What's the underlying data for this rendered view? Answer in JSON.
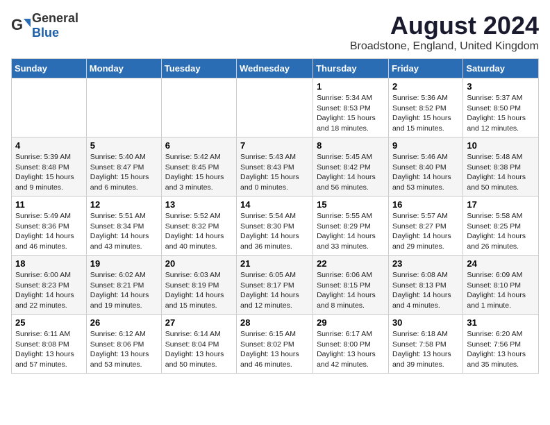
{
  "header": {
    "logo_general": "General",
    "logo_blue": "Blue",
    "month_year": "August 2024",
    "location": "Broadstone, England, United Kingdom"
  },
  "days_of_week": [
    "Sunday",
    "Monday",
    "Tuesday",
    "Wednesday",
    "Thursday",
    "Friday",
    "Saturday"
  ],
  "weeks": [
    [
      {
        "day": "",
        "info": ""
      },
      {
        "day": "",
        "info": ""
      },
      {
        "day": "",
        "info": ""
      },
      {
        "day": "",
        "info": ""
      },
      {
        "day": "1",
        "info": "Sunrise: 5:34 AM\nSunset: 8:53 PM\nDaylight: 15 hours\nand 18 minutes."
      },
      {
        "day": "2",
        "info": "Sunrise: 5:36 AM\nSunset: 8:52 PM\nDaylight: 15 hours\nand 15 minutes."
      },
      {
        "day": "3",
        "info": "Sunrise: 5:37 AM\nSunset: 8:50 PM\nDaylight: 15 hours\nand 12 minutes."
      }
    ],
    [
      {
        "day": "4",
        "info": "Sunrise: 5:39 AM\nSunset: 8:48 PM\nDaylight: 15 hours\nand 9 minutes."
      },
      {
        "day": "5",
        "info": "Sunrise: 5:40 AM\nSunset: 8:47 PM\nDaylight: 15 hours\nand 6 minutes."
      },
      {
        "day": "6",
        "info": "Sunrise: 5:42 AM\nSunset: 8:45 PM\nDaylight: 15 hours\nand 3 minutes."
      },
      {
        "day": "7",
        "info": "Sunrise: 5:43 AM\nSunset: 8:43 PM\nDaylight: 15 hours\nand 0 minutes."
      },
      {
        "day": "8",
        "info": "Sunrise: 5:45 AM\nSunset: 8:42 PM\nDaylight: 14 hours\nand 56 minutes."
      },
      {
        "day": "9",
        "info": "Sunrise: 5:46 AM\nSunset: 8:40 PM\nDaylight: 14 hours\nand 53 minutes."
      },
      {
        "day": "10",
        "info": "Sunrise: 5:48 AM\nSunset: 8:38 PM\nDaylight: 14 hours\nand 50 minutes."
      }
    ],
    [
      {
        "day": "11",
        "info": "Sunrise: 5:49 AM\nSunset: 8:36 PM\nDaylight: 14 hours\nand 46 minutes."
      },
      {
        "day": "12",
        "info": "Sunrise: 5:51 AM\nSunset: 8:34 PM\nDaylight: 14 hours\nand 43 minutes."
      },
      {
        "day": "13",
        "info": "Sunrise: 5:52 AM\nSunset: 8:32 PM\nDaylight: 14 hours\nand 40 minutes."
      },
      {
        "day": "14",
        "info": "Sunrise: 5:54 AM\nSunset: 8:30 PM\nDaylight: 14 hours\nand 36 minutes."
      },
      {
        "day": "15",
        "info": "Sunrise: 5:55 AM\nSunset: 8:29 PM\nDaylight: 14 hours\nand 33 minutes."
      },
      {
        "day": "16",
        "info": "Sunrise: 5:57 AM\nSunset: 8:27 PM\nDaylight: 14 hours\nand 29 minutes."
      },
      {
        "day": "17",
        "info": "Sunrise: 5:58 AM\nSunset: 8:25 PM\nDaylight: 14 hours\nand 26 minutes."
      }
    ],
    [
      {
        "day": "18",
        "info": "Sunrise: 6:00 AM\nSunset: 8:23 PM\nDaylight: 14 hours\nand 22 minutes."
      },
      {
        "day": "19",
        "info": "Sunrise: 6:02 AM\nSunset: 8:21 PM\nDaylight: 14 hours\nand 19 minutes."
      },
      {
        "day": "20",
        "info": "Sunrise: 6:03 AM\nSunset: 8:19 PM\nDaylight: 14 hours\nand 15 minutes."
      },
      {
        "day": "21",
        "info": "Sunrise: 6:05 AM\nSunset: 8:17 PM\nDaylight: 14 hours\nand 12 minutes."
      },
      {
        "day": "22",
        "info": "Sunrise: 6:06 AM\nSunset: 8:15 PM\nDaylight: 14 hours\nand 8 minutes."
      },
      {
        "day": "23",
        "info": "Sunrise: 6:08 AM\nSunset: 8:13 PM\nDaylight: 14 hours\nand 4 minutes."
      },
      {
        "day": "24",
        "info": "Sunrise: 6:09 AM\nSunset: 8:10 PM\nDaylight: 14 hours\nand 1 minute."
      }
    ],
    [
      {
        "day": "25",
        "info": "Sunrise: 6:11 AM\nSunset: 8:08 PM\nDaylight: 13 hours\nand 57 minutes."
      },
      {
        "day": "26",
        "info": "Sunrise: 6:12 AM\nSunset: 8:06 PM\nDaylight: 13 hours\nand 53 minutes."
      },
      {
        "day": "27",
        "info": "Sunrise: 6:14 AM\nSunset: 8:04 PM\nDaylight: 13 hours\nand 50 minutes."
      },
      {
        "day": "28",
        "info": "Sunrise: 6:15 AM\nSunset: 8:02 PM\nDaylight: 13 hours\nand 46 minutes."
      },
      {
        "day": "29",
        "info": "Sunrise: 6:17 AM\nSunset: 8:00 PM\nDaylight: 13 hours\nand 42 minutes."
      },
      {
        "day": "30",
        "info": "Sunrise: 6:18 AM\nSunset: 7:58 PM\nDaylight: 13 hours\nand 39 minutes."
      },
      {
        "day": "31",
        "info": "Sunrise: 6:20 AM\nSunset: 7:56 PM\nDaylight: 13 hours\nand 35 minutes."
      }
    ]
  ]
}
